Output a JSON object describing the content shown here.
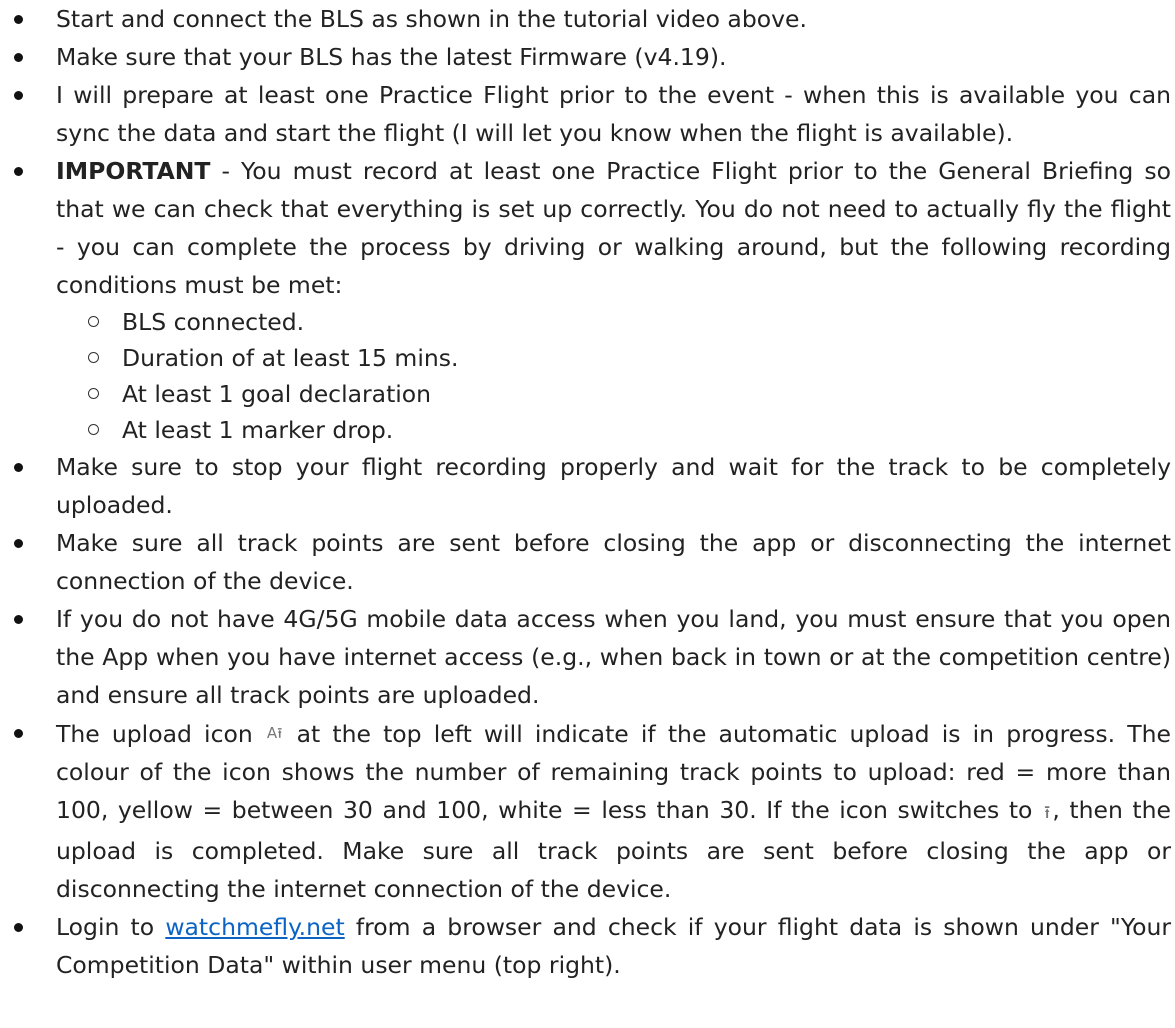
{
  "items": [
    {
      "text": "Start and connect the BLS as shown in the tutorial video above."
    },
    {
      "text": "Make sure that your BLS has the latest Firmware (v4.19)."
    },
    {
      "text": "I will prepare at least one Practice Flight prior to the event - when this is available you can sync the data and start the flight (I will let you know when the flight is available)."
    },
    {
      "bold": "IMPORTANT",
      "text": " - You must record at least one Practice Flight prior to the General Briefing so that we can check that everything is set up correctly. You do not need to actually fly the flight - you can complete the process by driving or walking around, but the following recording conditions must be met:",
      "subitems": [
        "BLS connected.",
        "Duration of at least 15 mins.",
        "At least 1 goal declaration",
        "At least 1 marker drop."
      ]
    },
    {
      "text": "Make sure to stop your flight recording properly and wait for the track to be completely uploaded."
    },
    {
      "text": "Make sure all track points are sent before closing the app or disconnecting the internet connection of the device."
    },
    {
      "text": "If you do not have 4G/5G mobile data access when you land, you must ensure that you open the App when you have internet access (e.g., when back in town or at the competition centre) and ensure all track points are uploaded."
    },
    {
      "text_a": "The upload icon",
      "icon_a": "A⭱",
      "icon_a_name": "upload-in-progress-icon",
      "text_b": "at the top left will indicate if the automatic upload is in progress. The colour of the icon shows the number of remaining track points to upload: red = more than 100, yellow = between 30 and 100, white = less than 30. If the icon switches to",
      "icon_b": "⭱",
      "icon_b_name": "upload-complete-icon",
      "text_c": ", then the upload is completed. Make sure all track points are sent before closing the app or disconnecting the internet connection of the device."
    },
    {
      "text_a": "Login to ",
      "link": "watchmefly.net",
      "text_b": " from a browser and check if your flight data is shown under \"Your Competition Data\" within user menu (top right)."
    }
  ],
  "colors": {
    "text": "#222222",
    "link": "#0b63c4"
  }
}
